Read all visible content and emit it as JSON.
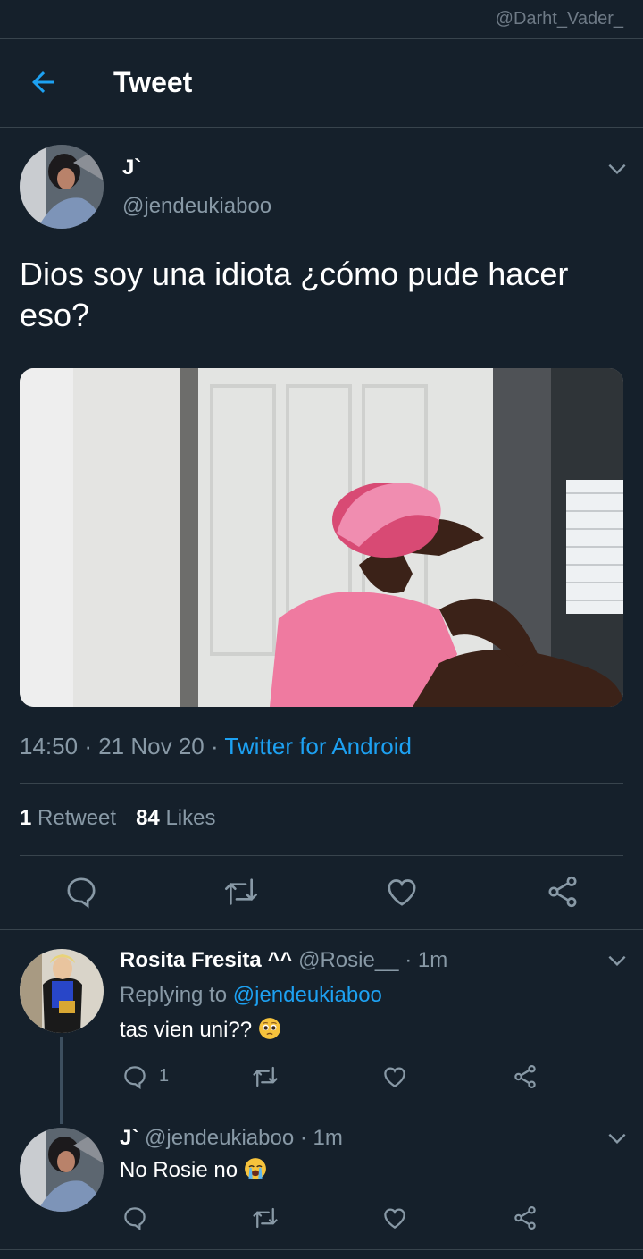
{
  "watermark": "@Darht_Vader_",
  "topbar": {
    "title": "Tweet",
    "back_icon": "arrow-left-icon"
  },
  "tweet": {
    "name": "J`",
    "handle": "@jendeukiaboo",
    "text": "Dios soy una idiota ¿cómo pude hacer eso?",
    "time": "14:50",
    "date": "21 Nov 20",
    "source": "Twitter for Android",
    "retweets_count": "1",
    "retweets_label": "Retweet",
    "likes_count": "84",
    "likes_label": "Likes"
  },
  "replies": [
    {
      "name": "Rosita Fresita ^^",
      "handle": "@Rosie__",
      "time": "1m",
      "replying_label": "Replying to",
      "replying_to": "@jendeukiaboo",
      "text": "tas vien uni??",
      "emoji": "pleading-face",
      "reply_count": "1"
    },
    {
      "name": "J`",
      "handle": "@jendeukiaboo",
      "time": "1m",
      "text": "No Rosie no",
      "emoji": "crying-face"
    }
  ],
  "colors": {
    "background": "#15202b",
    "accent": "#1da1f2",
    "muted": "#8899a6",
    "divider": "#38444d"
  },
  "separator": "·"
}
